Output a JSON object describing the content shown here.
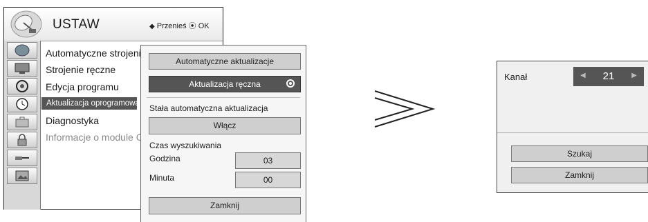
{
  "menu": {
    "title": "USTAW",
    "hint_arrows": "◆",
    "hint_move": "Przenieś",
    "hint_ok": "OK",
    "icons": [
      "satellite-dish-icon",
      "globe-icon",
      "tv-screen-icon",
      "disc-icon",
      "clock-icon",
      "lock-icon",
      "antenna-cable-icon",
      "slot-icon",
      "picture-icon"
    ],
    "items": [
      {
        "label": "Automatyczne strojenie"
      },
      {
        "label": "Strojenie ręczne"
      },
      {
        "label": "Edycja programu"
      },
      {
        "label": "Aktualizacja oprogramowania",
        "selected": true
      },
      {
        "label": "Diagnostyka"
      },
      {
        "label": "Informacje o module CI",
        "disabled": true
      }
    ]
  },
  "submenu": {
    "auto_update": "Automatyczne aktualizacje",
    "manual_update": "Aktualizacja ręczna",
    "permanent_label": "Stała automatyczna aktualizacja",
    "permanent_value": "Włącz",
    "search_time_label": "Czas wyszukiwania",
    "hour_label": "Godzina",
    "hour_value": "03",
    "minute_label": "Minuta",
    "minute_value": "00",
    "close": "Zamknij"
  },
  "dialog": {
    "channel_label": "Kanał",
    "channel_value": "21",
    "search": "Szukaj",
    "close": "Zamknij"
  },
  "colors": {
    "selected_bg": "#555555",
    "button_bg": "#cfcfcf"
  }
}
